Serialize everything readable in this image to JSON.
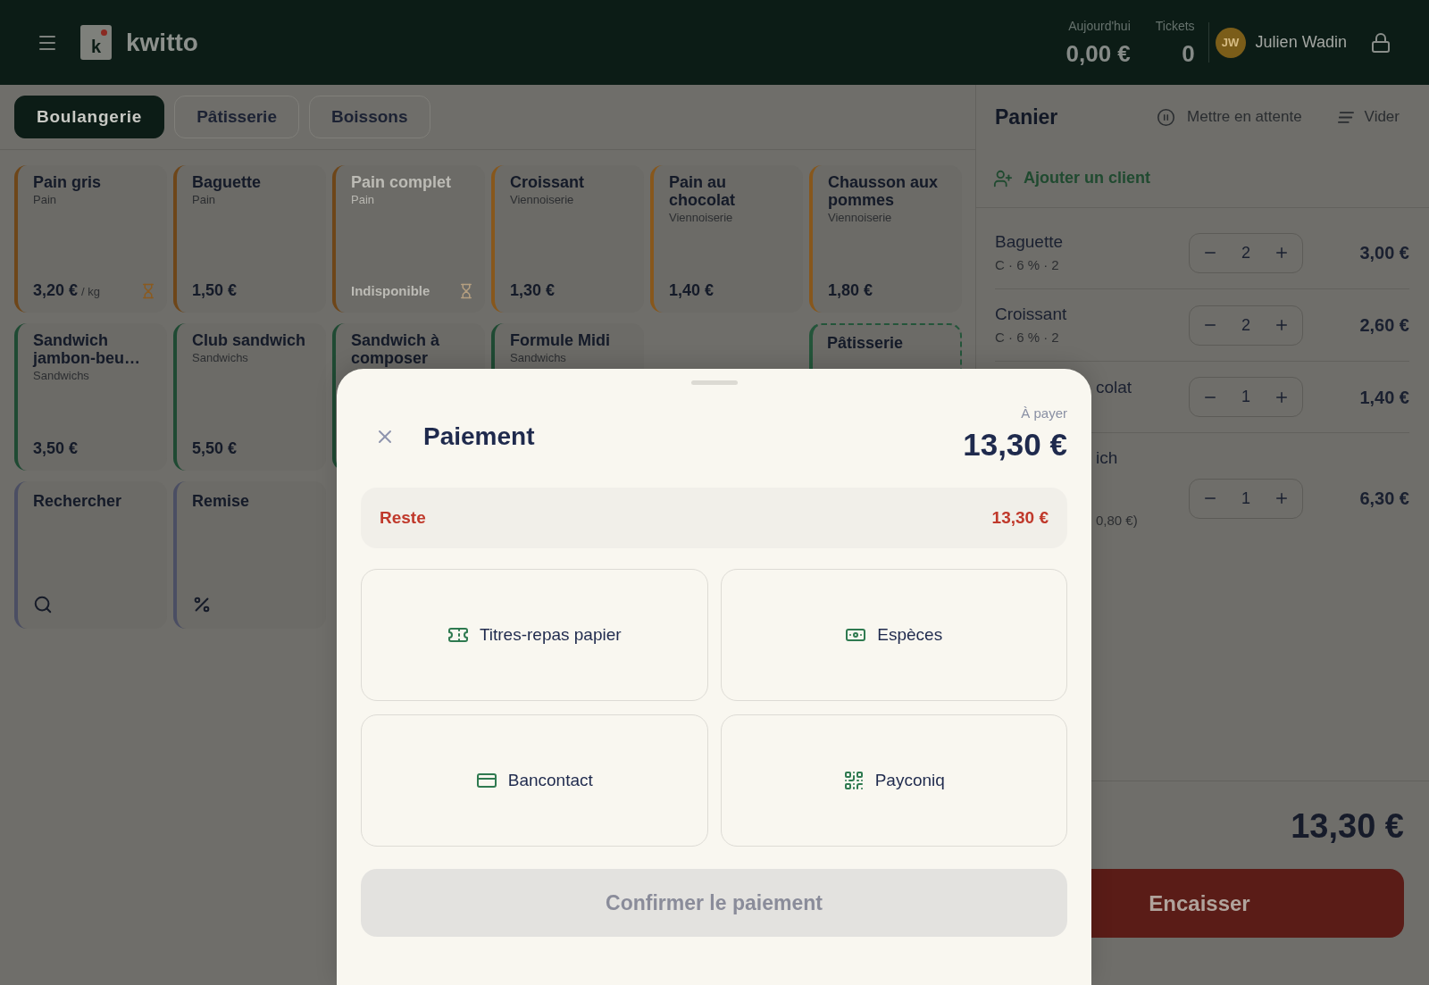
{
  "header": {
    "logo": {
      "mark": "k",
      "name": "kwitto"
    },
    "stats": [
      {
        "label": "Aujourd'hui",
        "value": "0,00 €"
      },
      {
        "label": "Tickets",
        "value": "0"
      }
    ],
    "user": {
      "initials": "JW",
      "name": "Julien Wadin"
    }
  },
  "tabs": [
    {
      "label": "Boulangerie",
      "selected": true
    },
    {
      "label": "Pâtisserie",
      "selected": false
    },
    {
      "label": "Boissons",
      "selected": false
    }
  ],
  "tiles": [
    {
      "kind": "product",
      "title": "Pain gris",
      "category": "Pain",
      "price": "3,20 €",
      "unit": "/ kg",
      "available": true,
      "weighed": true,
      "color": "#6e4619"
    },
    {
      "kind": "product",
      "title": "Baguette",
      "category": "Pain",
      "price": "1,50 €",
      "available": true,
      "weighed": false,
      "color": "#6e4619"
    },
    {
      "kind": "product",
      "title": "Pain complet",
      "category": "Pain",
      "status": "Indisponible",
      "available": false,
      "weighed": true,
      "color": "#6e4619"
    },
    {
      "kind": "product",
      "title": "Croissant",
      "category": "Viennoiserie",
      "price": "1,30 €",
      "available": true,
      "weighed": false,
      "color": "#87571c"
    },
    {
      "kind": "product",
      "title": "Pain au chocolat",
      "category": "Viennoiserie",
      "price": "1,40 €",
      "available": true,
      "weighed": false,
      "color": "#87571c"
    },
    {
      "kind": "product",
      "title": "Chausson aux pommes",
      "category": "Viennoiserie",
      "price": "1,80 €",
      "available": true,
      "weighed": false,
      "color": "#87571c"
    },
    {
      "kind": "product",
      "title": "Sandwich jambon-beu…",
      "category": "Sandwichs",
      "price": "3,50 €",
      "available": true,
      "weighed": false,
      "color": "#1f4a33"
    },
    {
      "kind": "product",
      "title": "Club sandwich",
      "category": "Sandwichs",
      "price": "5,50 €",
      "available": true,
      "weighed": false,
      "color": "#1f4a33"
    },
    {
      "kind": "product",
      "title": "Sandwich à composer",
      "available": true,
      "weighed": false,
      "color": "#1f4a33"
    },
    {
      "kind": "product",
      "title": "Formule Midi",
      "category": "Sandwichs",
      "available": true,
      "weighed": false,
      "color": "#1f4a33"
    },
    {
      "kind": "category",
      "title": "Pâtisserie",
      "color": "#24553a"
    },
    {
      "kind": "search",
      "title": "Rechercher",
      "color": "#4b4e63"
    },
    {
      "kind": "discount",
      "title": "Remise",
      "color": "#4b4e63"
    }
  ],
  "cart": {
    "title": "Panier",
    "actions": [
      {
        "kind": "hold",
        "label": "Mettre en attente"
      },
      {
        "kind": "clear",
        "label": "Vider"
      }
    ],
    "add_customer": "Ajouter un client",
    "items": [
      {
        "kind": "full",
        "name": "Baguette",
        "detail": "C · 6 % · 2",
        "quantity": "2",
        "price": "3,00 €"
      },
      {
        "kind": "full",
        "name": "Croissant",
        "detail": "C · 6 % · 2",
        "quantity": "2",
        "price": "2,60 €"
      },
      {
        "kind": "partial",
        "name": "colat",
        "quantity": "1",
        "price": "1,40 €"
      },
      {
        "kind": "partial",
        "name": "ich",
        "detail": "0,80 €)",
        "quantity": "1",
        "price": "6,30 €"
      }
    ],
    "total": "13,30 €",
    "checkout": "Encaisser"
  },
  "payment": {
    "title": "Paiement",
    "due_label": "À payer",
    "due": "13,30 €",
    "remaining_label": "Reste",
    "remaining": "13,30 €",
    "methods": [
      {
        "kind": "ticket",
        "label": "Titres-repas papier"
      },
      {
        "kind": "cash",
        "label": "Espèces"
      },
      {
        "kind": "card",
        "label": "Bancontact"
      },
      {
        "kind": "qr",
        "label": "Payconiq"
      }
    ],
    "confirm": {
      "label": "Confirmer le paiement",
      "disabled": true
    }
  }
}
